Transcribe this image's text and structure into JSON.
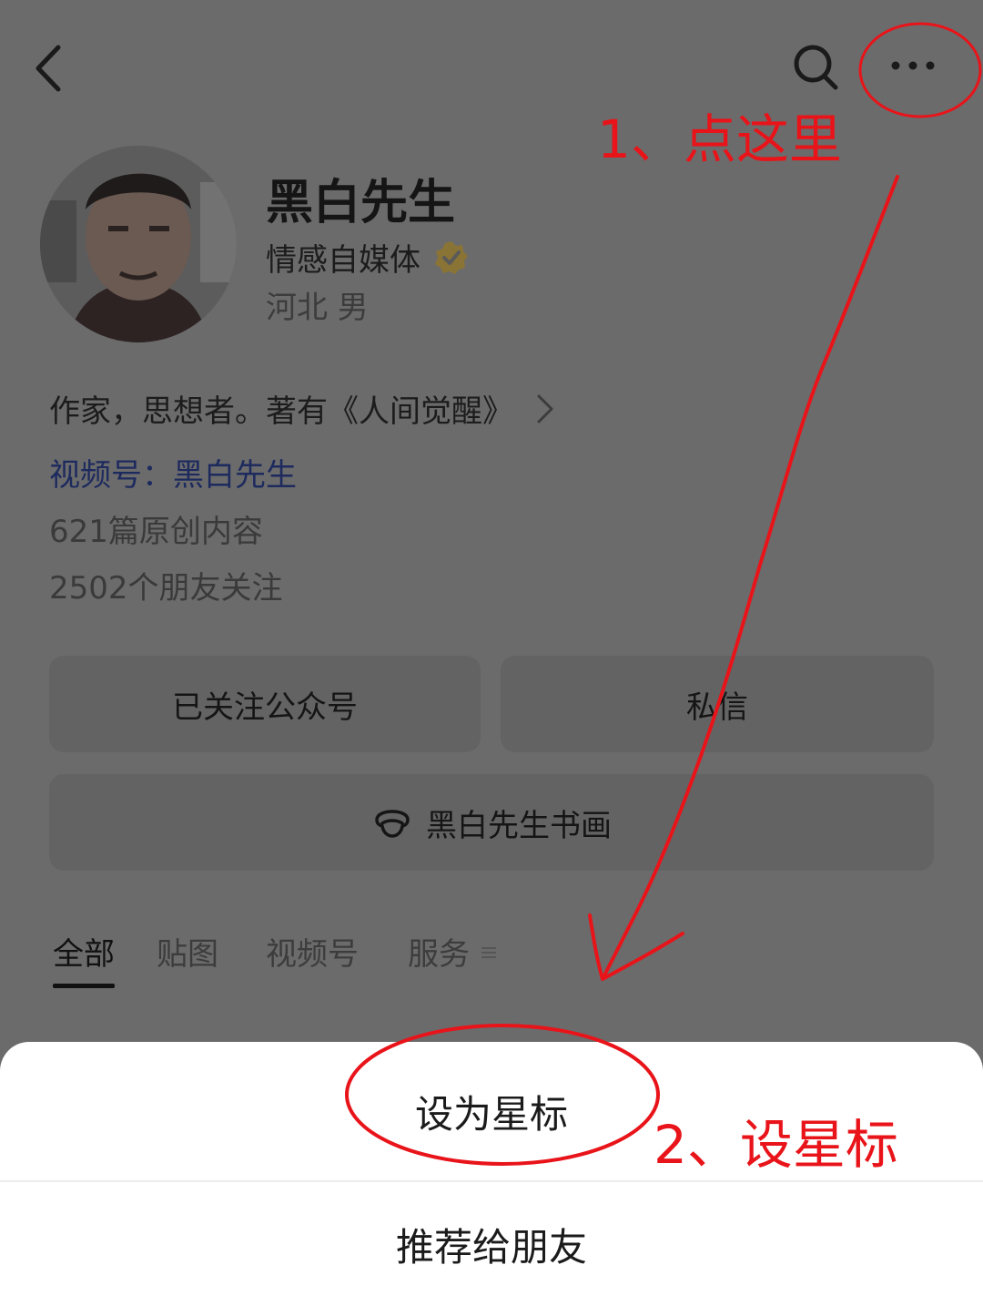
{
  "header": {
    "back_icon": "chevron-left-icon",
    "search_icon": "search-icon",
    "more_icon": "more-horizontal-icon"
  },
  "profile": {
    "name": "黑白先生",
    "subtitle": "情感自媒体",
    "verified_icon": "verified-badge-icon",
    "verified_color": "#c9a227",
    "location": "河北 男",
    "bio": "作家，思想者。著有《人间觉醒》",
    "video_channel": "视频号：黑白先生",
    "articles": "621篇原创内容",
    "followers": "2502个朋友关注"
  },
  "actions": {
    "followed_label": "已关注公众号",
    "message_label": "私信",
    "mini_program_label": "黑白先生书画",
    "mini_program_icon": "mini-program-icon"
  },
  "tabs": [
    {
      "label": "全部",
      "active": true
    },
    {
      "label": "贴图",
      "active": false
    },
    {
      "label": "视频号",
      "active": false
    },
    {
      "label": "服务",
      "active": false
    }
  ],
  "sheet": {
    "items": [
      {
        "label": "设为星标"
      },
      {
        "label": "推荐给朋友"
      }
    ]
  },
  "annotations": {
    "step1": "1、点这里",
    "step2": "2、设星标",
    "color": "#e8141a"
  }
}
